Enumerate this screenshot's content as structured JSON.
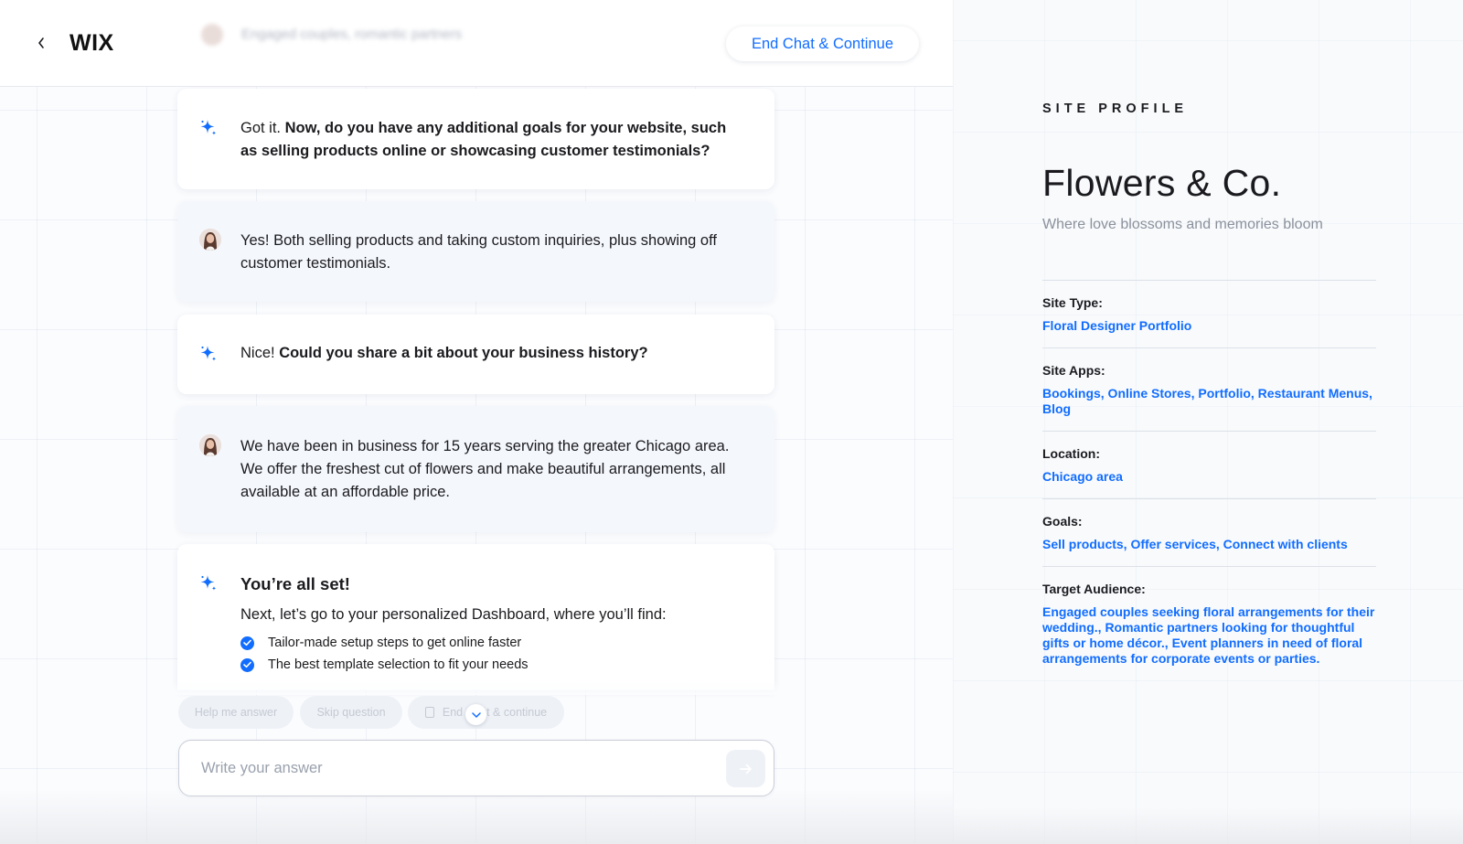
{
  "header": {
    "logo": "WIX",
    "ghost_preview": "Engaged couples, romantic partners",
    "end_chat_label": "End Chat & Continue"
  },
  "messages": [
    {
      "role": "assistant",
      "intro": "Got it.",
      "bold": "Now, do you have any additional goals for your website, such as selling products online or showcasing customer testimonials?"
    },
    {
      "role": "user",
      "text": "Yes! Both selling products and taking custom inquiries, plus showing off customer testimonials."
    },
    {
      "role": "assistant",
      "intro": "Nice!",
      "bold": "Could you share a bit about your business history?"
    },
    {
      "role": "user",
      "text": "We have been in business for 15 years serving the greater Chicago area. We offer the freshest cut of flowers and make beautiful arrangements, all available at an affordable price."
    }
  ],
  "final_message": {
    "title": "You’re all set!",
    "lead": "Next, let’s go to your personalized Dashboard, where you’ll find:",
    "items": [
      "Tailor-made setup steps to get online faster",
      "The best template selection to fit your needs"
    ]
  },
  "suggestions": {
    "help": "Help me answer",
    "skip": "Skip question",
    "end_prefix": "End",
    "end_suffix": "t & continue"
  },
  "composer": {
    "placeholder": "Write your answer"
  },
  "profile": {
    "eyebrow": "SITE PROFILE",
    "name": "Flowers & Co.",
    "tagline": "Where love blossoms and memories bloom",
    "fields": [
      {
        "label": "Site Type:",
        "value": "Floral Designer Portfolio"
      },
      {
        "label": "Site Apps:",
        "value": "Bookings, Online Stores, Portfolio, Restaurant Menus, Blog"
      },
      {
        "label": "Location:",
        "value": "Chicago area"
      },
      {
        "label": "Goals:",
        "value": "Sell products, Offer services, Connect with clients"
      },
      {
        "label": "Target Audience:",
        "value": "Engaged couples seeking floral arrangements for their wedding., Romantic partners looking for thoughtful gifts or home décor., Event planners in need of floral arrangements for corporate events or parties."
      }
    ]
  },
  "colors": {
    "accent": "#116dff",
    "ai_bubble": "#ffffff",
    "user_bubble": "#f4f7fc"
  },
  "icons": {
    "back": "chevron-left-icon",
    "assistant": "sparkle-icon",
    "check": "check-circle-icon",
    "send": "arrow-right-icon",
    "scroll": "chevron-down-icon"
  }
}
